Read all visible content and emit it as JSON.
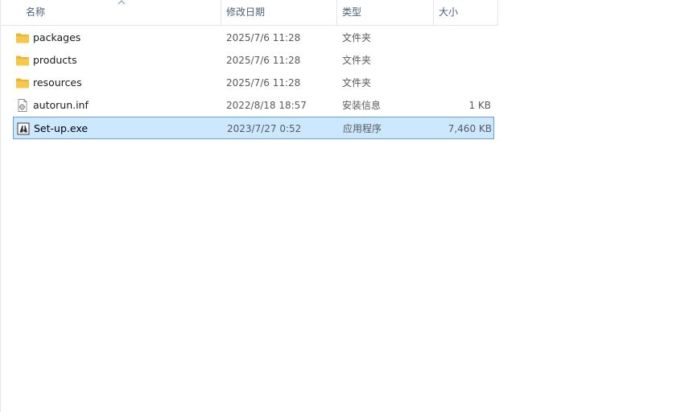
{
  "columns": {
    "name": "名称",
    "date": "修改日期",
    "type": "类型",
    "size": "大小"
  },
  "sort": {
    "column": "name",
    "icon": "chevron-up-icon"
  },
  "files": [
    {
      "name": "packages",
      "date": "2025/7/6 11:28",
      "type": "文件夹",
      "size": "",
      "icon": "folder-icon",
      "selected": false
    },
    {
      "name": "products",
      "date": "2025/7/6 11:28",
      "type": "文件夹",
      "size": "",
      "icon": "folder-icon",
      "selected": false
    },
    {
      "name": "resources",
      "date": "2025/7/6 11:28",
      "type": "文件夹",
      "size": "",
      "icon": "folder-icon",
      "selected": false
    },
    {
      "name": "autorun.inf",
      "date": "2022/8/18 18:57",
      "type": "安装信息",
      "size": "1 KB",
      "icon": "settings-file-icon",
      "selected": false
    },
    {
      "name": "Set-up.exe",
      "date": "2023/7/27 0:52",
      "type": "应用程序",
      "size": "7,460 KB",
      "icon": "adobe-app-icon",
      "selected": true
    }
  ],
  "colors": {
    "selection_bg": "#cce8ff",
    "selection_border": "#6a9ed8",
    "header_text": "#4c607a",
    "folder": "#f8c74a"
  }
}
